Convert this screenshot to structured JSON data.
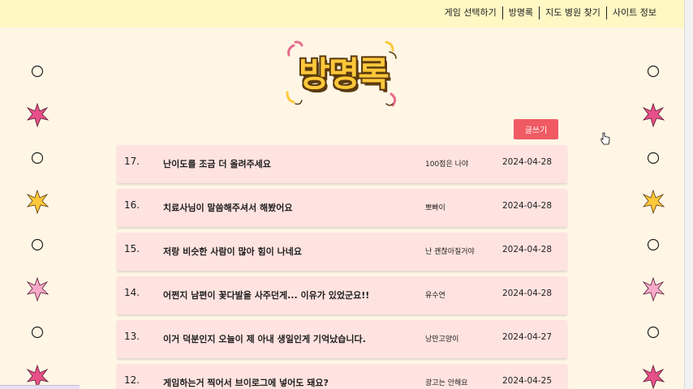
{
  "nav": {
    "items": [
      "게임 선택하기",
      "방명록",
      "지도 병원 찾기",
      "사이트 정보"
    ]
  },
  "logo": {
    "text": "방명록"
  },
  "write_button": {
    "label": "글쓰기"
  },
  "entries": [
    {
      "num": "17.",
      "title": "난이도를 조금 더 올려주세요",
      "author": "100점은 나야",
      "date": "2024-04-28"
    },
    {
      "num": "16.",
      "title": "치료사님이 말씀해주셔서 해봤어요",
      "author": "뽀빠이",
      "date": "2024-04-28"
    },
    {
      "num": "15.",
      "title": "저랑 비슷한 사람이 많아 힘이 나네요",
      "author": "난 괜찮아질거야",
      "date": "2024-04-28"
    },
    {
      "num": "14.",
      "title": "어쩐지 남편이 꽃다발을 사주던게... 이유가 있었군요!!",
      "author": "유수연",
      "date": "2024-04-28"
    },
    {
      "num": "13.",
      "title": "이거 덕분인지 오늘이 제 아내 생일인게 기억났습니다.",
      "author": "낭만고양이",
      "date": "2024-04-27"
    },
    {
      "num": "12.",
      "title": "게임하는거 찍어서 브이로그에 넣어도 돼요?",
      "author": "광고는 안해요",
      "date": "2024-04-25"
    }
  ],
  "colors": {
    "background": "#fff6e6",
    "topbar": "#fff8c4",
    "row": "#ffe3e0",
    "button": "#f05a63",
    "logo": "#ffc83a"
  }
}
